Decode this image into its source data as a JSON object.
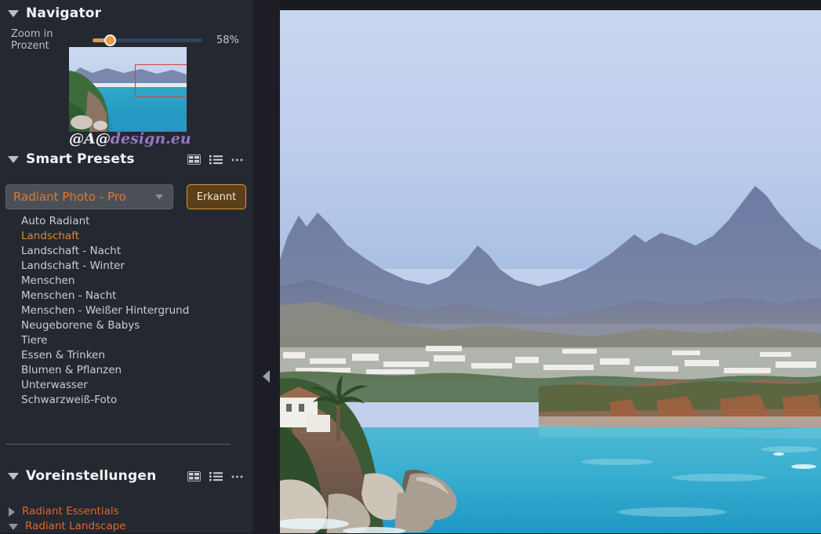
{
  "navigator": {
    "title": "Navigator",
    "caret_icon": "caret-down-icon",
    "zoom_label": "Zoom in Prozent",
    "zoom_value": "58%",
    "zoom_percent": 58,
    "watermark_primary": "@A@",
    "watermark_secondary": "design.eu",
    "crop_rect_color": "#d2423a"
  },
  "smart_presets": {
    "title": "Smart Presets",
    "caret_icon": "caret-down-icon",
    "grid_icon": "grid-view-icon",
    "list_icon": "list-view-icon",
    "more_icon": "more-options-icon",
    "selected_profile": "Radiant Photo - Pro",
    "dropdown_icon": "chevron-down-icon",
    "detect_button": "Erkannt",
    "accent_color": "#e0772e",
    "items": [
      {
        "label": "Auto Radiant",
        "active": false
      },
      {
        "label": "Landschaft",
        "active": true
      },
      {
        "label": "Landschaft - Nacht",
        "active": false
      },
      {
        "label": "Landschaft - Winter",
        "active": false
      },
      {
        "label": "Menschen",
        "active": false
      },
      {
        "label": "Menschen - Nacht",
        "active": false
      },
      {
        "label": "Menschen - Weißer Hintergrund",
        "active": false
      },
      {
        "label": "Neugeborene & Babys",
        "active": false
      },
      {
        "label": "Tiere",
        "active": false
      },
      {
        "label": "Essen & Trinken",
        "active": false
      },
      {
        "label": "Blumen & Pflanzen",
        "active": false
      },
      {
        "label": "Unterwasser",
        "active": false
      },
      {
        "label": "Schwarzweiß-Foto",
        "active": false
      }
    ]
  },
  "presets_section": {
    "title": "Voreinstellungen",
    "caret_icon": "caret-down-icon",
    "grid_icon": "grid-view-icon",
    "list_icon": "list-view-icon",
    "more_icon": "more-options-icon",
    "groups": [
      {
        "label": "Radiant Essentials",
        "expanded": false,
        "caret_icon": "caret-right-icon"
      },
      {
        "label": "Radiant Landscape",
        "expanded": true,
        "caret_icon": "caret-down-icon"
      }
    ]
  },
  "panel": {
    "collapse_icon": "collapse-left-icon",
    "background_color": "#242831",
    "gutter_color": "#1d1e25"
  },
  "photo": {
    "description": "coastal landscape with turquoise bay, rocky cliffs, white town and mountains",
    "sky_top_color": "#c6d4ef",
    "sky_bottom_color": "#a9c0e4",
    "mountain_color": "#6e7a9e",
    "sea_color": "#3fb4cf",
    "cliff_color": "#7b5648"
  }
}
